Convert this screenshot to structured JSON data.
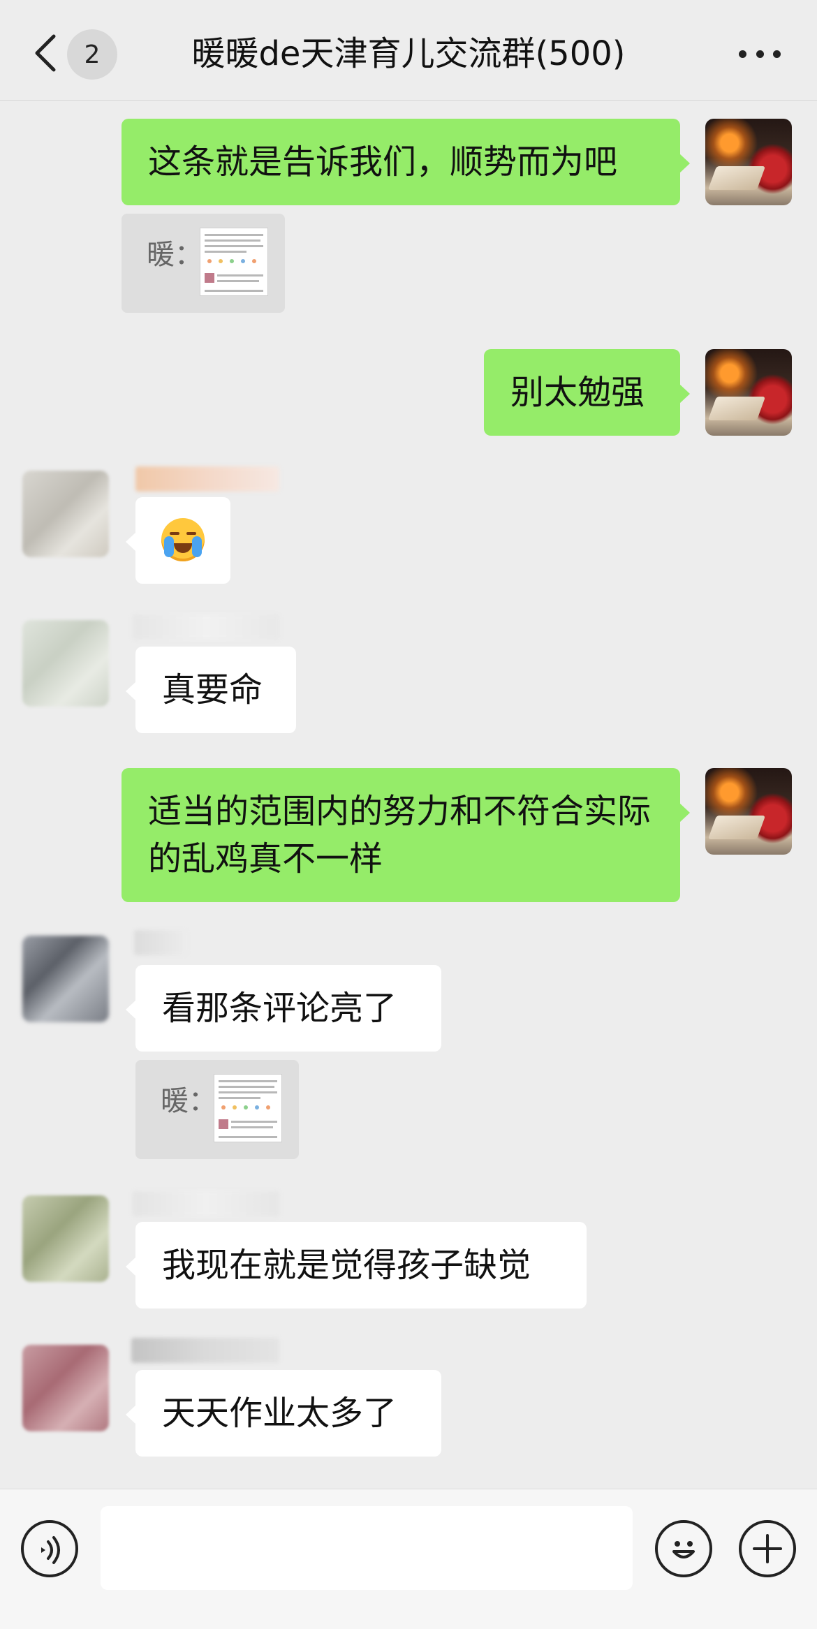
{
  "header": {
    "back_icon": "chevron-left-icon",
    "unread_count": "2",
    "title": "暖暖de天津育儿交流群(500)",
    "more_icon": "more-dots-icon"
  },
  "messages": [
    {
      "side": "self",
      "type": "text",
      "text": "这条就是告诉我们，顺势而为吧"
    },
    {
      "side": "self",
      "type": "quote",
      "label": "暖："
    },
    {
      "side": "self",
      "type": "text",
      "text": "别太勉强"
    },
    {
      "side": "other",
      "type": "emoji",
      "emoji": "loudly-crying-face"
    },
    {
      "side": "other",
      "type": "text",
      "text": "真要命"
    },
    {
      "side": "self",
      "type": "text",
      "text": "适当的范围内的努力和不符合实际的乱鸡真不一样"
    },
    {
      "side": "other",
      "type": "text",
      "text": "看那条评论亮了"
    },
    {
      "side": "other",
      "type": "quote",
      "label": "暖："
    },
    {
      "side": "other",
      "type": "text",
      "text": "我现在就是觉得孩子缺觉"
    },
    {
      "side": "other",
      "type": "text",
      "text": "天天作业太多了"
    }
  ],
  "input_bar": {
    "voice_icon": "voice-icon",
    "input_value": "",
    "emoji_icon": "emoji-icon",
    "plus_icon": "plus-icon"
  },
  "colors": {
    "self_bubble": "#95ec69",
    "other_bubble": "#ffffff",
    "background": "#ededed"
  }
}
